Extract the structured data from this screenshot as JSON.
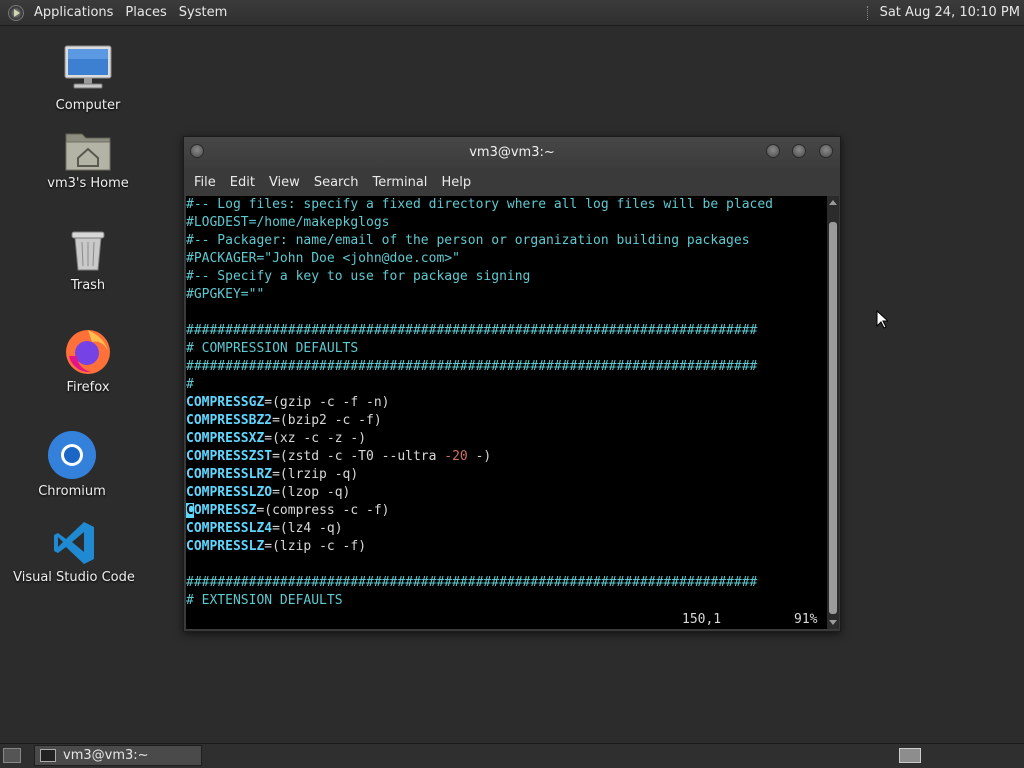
{
  "top_panel": {
    "menus": [
      "Applications",
      "Places",
      "System"
    ],
    "clock": "Sat Aug 24, 10:10 PM"
  },
  "desktop": {
    "icons": [
      {
        "label": "Computer",
        "icon": "computer-icon"
      },
      {
        "label": "vm3's Home",
        "icon": "home-folder-icon"
      },
      {
        "label": "Trash",
        "icon": "trash-icon"
      },
      {
        "label": "Firefox",
        "icon": "firefox-icon"
      },
      {
        "label": "Chromium",
        "icon": "chromium-icon"
      },
      {
        "label": "Visual Studio Code",
        "icon": "vscode-icon"
      }
    ]
  },
  "terminal": {
    "title": "vm3@vm3:~",
    "menu": [
      "File",
      "Edit",
      "View",
      "Search",
      "Terminal",
      "Help"
    ],
    "lines": [
      {
        "type": "comment",
        "text": "#-- Log files: specify a fixed directory where all log files will be placed"
      },
      {
        "type": "comment",
        "text": "#LOGDEST=/home/makepkglogs"
      },
      {
        "type": "comment",
        "text": "#-- Packager: name/email of the person or organization building packages"
      },
      {
        "type": "comment",
        "text": "#PACKAGER=\"John Doe <john@doe.com>\""
      },
      {
        "type": "comment",
        "text": "#-- Specify a key to use for package signing"
      },
      {
        "type": "comment",
        "text": "#GPGKEY=\"\""
      },
      {
        "type": "blank",
        "text": ""
      },
      {
        "type": "comment",
        "text": "#########################################################################"
      },
      {
        "type": "comment",
        "text": "# COMPRESSION DEFAULTS"
      },
      {
        "type": "comment",
        "text": "#########################################################################"
      },
      {
        "type": "comment",
        "text": "#"
      },
      {
        "type": "assign",
        "key": "COMPRESSGZ",
        "value": "=(gzip -c -f -n)"
      },
      {
        "type": "assign",
        "key": "COMPRESSBZ2",
        "value": "=(bzip2 -c -f)"
      },
      {
        "type": "assign",
        "key": "COMPRESSXZ",
        "value": "=(xz -c -z -)"
      },
      {
        "type": "assign",
        "key": "COMPRESSZST",
        "value": "=(zstd -c -T0 --ultra ",
        "num": "-20",
        "tail": " -)"
      },
      {
        "type": "assign",
        "key": "COMPRESSLRZ",
        "value": "=(lrzip -q)"
      },
      {
        "type": "assign",
        "key": "COMPRESSLZO",
        "value": "=(lzop -q)"
      },
      {
        "type": "assign",
        "key": "COMPRESSZ",
        "value": "=(compress -c -f)",
        "cursor": true
      },
      {
        "type": "assign",
        "key": "COMPRESSLZ4",
        "value": "=(lz4 -q)"
      },
      {
        "type": "assign",
        "key": "COMPRESSLZ",
        "value": "=(lzip -c -f)"
      },
      {
        "type": "blank",
        "text": ""
      },
      {
        "type": "comment",
        "text": "#########################################################################"
      },
      {
        "type": "comment",
        "text": "# EXTENSION DEFAULTS"
      }
    ],
    "status": {
      "position": "150,1",
      "percent": "91%"
    },
    "scroll_position": 0.91
  },
  "bottom_panel": {
    "task_label": "vm3@vm3:~"
  }
}
